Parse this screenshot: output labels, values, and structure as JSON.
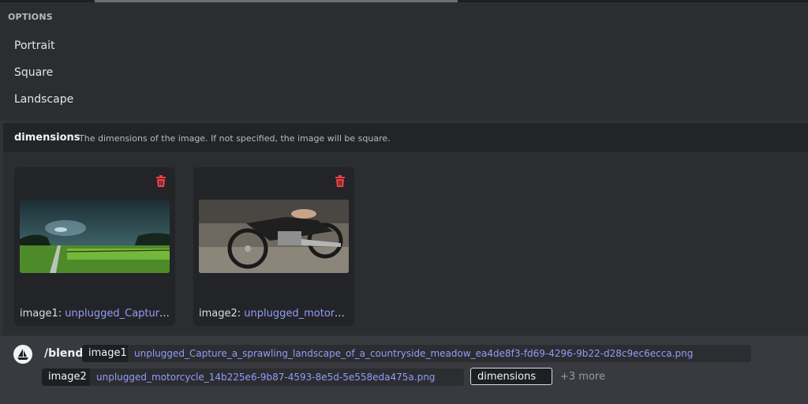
{
  "options": {
    "header": "OPTIONS",
    "items": [
      "Portrait",
      "Square",
      "Landscape"
    ]
  },
  "parameter": {
    "name": "dimensions",
    "description": "The dimensions of the image. If not specified, the image will be square."
  },
  "attachments": [
    {
      "label": "image1:",
      "file": "unplugged_Capture..."
    },
    {
      "label": "image2:",
      "file": "unplugged_motorc..."
    }
  ],
  "command": {
    "name": "/blend",
    "image1_label": "image1",
    "image1_value": "unplugged_Capture_a_sprawling_landscape_of_a_countryside_meadow_ea4de8f3-fd69-4296-9b22-d28c9ec6ecca.png",
    "image2_label": "image2",
    "image2_value": "unplugged_motorcycle_14b225e6-9b87-4593-8e5d-5e558eda475a.png",
    "active_option": "dimensions",
    "more": "+3 more"
  },
  "colors": {
    "link": "#949cf7",
    "delete": "#f23f43",
    "background": "#313338"
  },
  "icons": {
    "delete": "trash-icon",
    "avatar": "sailboat-icon"
  }
}
